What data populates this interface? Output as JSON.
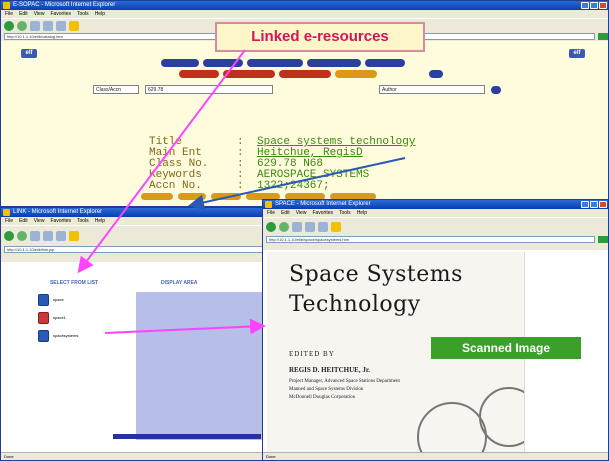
{
  "callouts": {
    "linked": "Linked  e-resources",
    "scanned": "Scanned Image"
  },
  "catalog_window": {
    "title": "E-SOPAC - Microsoft Internet Explorer",
    "menu": [
      "File",
      "Edit",
      "View",
      "Favorites",
      "Tools",
      "Help"
    ],
    "address": "http://10.1.1.10/elib/catalog.htm",
    "logo": "elf",
    "search": {
      "field_label": "Class/Accn",
      "field_value": "629.78",
      "type_value": "Author"
    },
    "record": [
      {
        "label": "Title",
        "sep": ":",
        "value": "Space systems technology"
      },
      {
        "label": "Main Ent",
        "sep": ":",
        "value": "Heitchue, RegisD"
      },
      {
        "label": "Class No.",
        "sep": ":",
        "value": "629.78 N68"
      },
      {
        "label": "Keywords",
        "sep": ":",
        "value": "AEROSPACE SYSTEMS"
      },
      {
        "label": "Accn No.",
        "sep": ":",
        "value": "1322;24367;"
      }
    ]
  },
  "select_window": {
    "title": "LINK - Microsoft Internet Explorer",
    "menu": [
      "File",
      "Edit",
      "View",
      "Favorites",
      "Tools",
      "Help"
    ],
    "address": "http://10.1.1.10/elib/link.jsp",
    "list_heading": "SELECT FROM LIST",
    "display_heading": "DISPLAY AREA",
    "files": [
      "space",
      "space1",
      "spacesystems"
    ],
    "status": "Done"
  },
  "scan_window": {
    "title": "SPACE - Microsoft Internet Explorer",
    "menu": [
      "File",
      "Edit",
      "View",
      "Favorites",
      "Tools",
      "Help"
    ],
    "address": "http://10.1.1.10/elib/space/spacesystems.htm",
    "book_title_line1": "Space Systems",
    "book_title_line2": "Technology",
    "edited_by": "EDITED BY",
    "editor": "REGIS D. HEITCHUE, Jr.",
    "affiliation": [
      "Project Manager, Advanced Space Stations Department",
      "Manned and Space Systems Division",
      "McDonnell Douglas Corporation"
    ],
    "status": "Done"
  },
  "colors": {
    "catalog_bg": "#fffbdd",
    "record_value": "#3a8a10",
    "callout_text": "#d4145a",
    "scanned_callout": "#3aa02a",
    "arrow": "#ff44ff"
  }
}
